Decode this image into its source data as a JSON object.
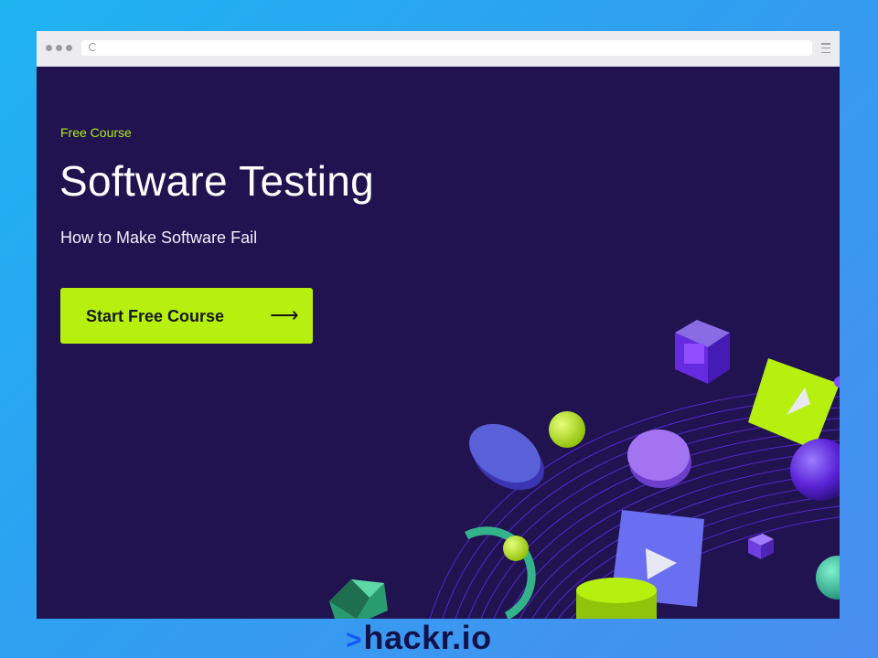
{
  "hero": {
    "eyebrow": "Free Course",
    "title": "Software Testing",
    "subtitle": "How to Make Software Fail",
    "cta_label": "Start Free Course",
    "cta_arrow": "⟶"
  },
  "brand": {
    "prompt": ">",
    "name": "hackr.io"
  },
  "colors": {
    "page_background": "#1fb3f2",
    "hero_background": "#20134f",
    "accent": "#b7f00f",
    "shape_purple": "#8b5cf6",
    "shape_blue": "#5b6cf0",
    "shape_green": "#2fbf8f"
  },
  "icons": [
    "reload-icon",
    "menu-icon",
    "play-icon",
    "arrow-right-icon"
  ]
}
